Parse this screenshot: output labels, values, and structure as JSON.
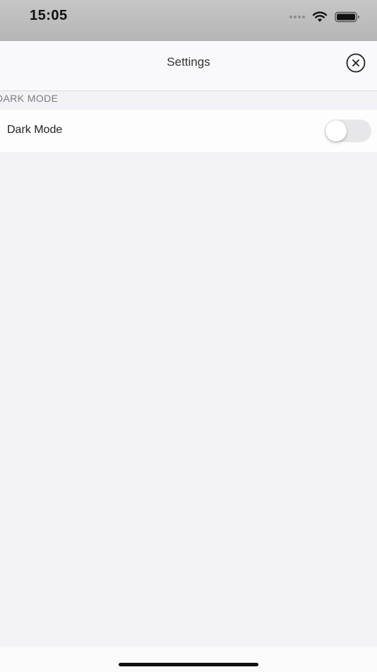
{
  "status_bar": {
    "time": "15:05",
    "icons": [
      "signal-icon",
      "wifi-icon",
      "battery-icon"
    ]
  },
  "nav": {
    "title": "Settings",
    "close_icon": "close-circle-icon"
  },
  "section": {
    "header": "DARK MODE"
  },
  "settings_rows": [
    {
      "label": "Dark Mode",
      "toggle_on": false
    }
  ],
  "colors": {
    "background": "#f2f2f7",
    "toggle_off": "#e7e7ea",
    "cell": "#fdfdfd"
  }
}
